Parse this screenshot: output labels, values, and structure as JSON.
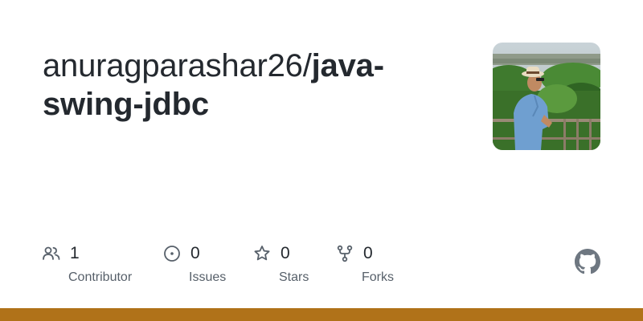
{
  "repo": {
    "owner": "anuragparashar26/",
    "name": "java-swing-jdbc"
  },
  "stats": [
    {
      "icon": "people-icon",
      "count": "1",
      "label": "Contributor"
    },
    {
      "icon": "issue-opened-icon",
      "count": "0",
      "label": "Issues"
    },
    {
      "icon": "star-icon",
      "count": "0",
      "label": "Stars"
    },
    {
      "icon": "repo-forked-icon",
      "count": "0",
      "label": "Forks"
    }
  ],
  "colors": {
    "language_bar": "#b07219",
    "text_primary": "#24292f",
    "text_secondary": "#57606a"
  },
  "brand_icon": "github-mark-icon",
  "avatar_icon": "user-avatar-photo"
}
